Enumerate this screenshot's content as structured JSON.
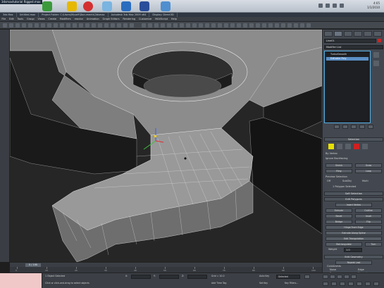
{
  "taskbar": {
    "title": "3dsmaxtutorial Rigged.max",
    "clock_time": "4:05",
    "clock_date": "1/1/2010",
    "icon_colors": [
      "#3a9a3a",
      "#e6b800",
      "#d43030",
      "#7ab4e0",
      "#2a6dbf",
      "#2b4e9a",
      "#4f8fcf"
    ]
  },
  "max_window": {
    "title_segments": [
      "3ds Max",
      "Untitled.max",
      "Project Folder: C:\\Users\\Myself\\Documents\\3dsmax",
      "Autodesk 3ds Max 2009 x64",
      "Display: Direct3D"
    ],
    "menu_items": [
      "File",
      "Edit",
      "Tools",
      "Group",
      "Views",
      "Create",
      "Modifiers",
      "reactor",
      "Animation",
      "Graph Editors",
      "Rendering",
      "Customize",
      "MAXScript",
      "Help"
    ]
  },
  "command_panel": {
    "object_name": "Line01",
    "modifier_list": "Modifier List",
    "stack_items": [
      {
        "label": "TurboSmooth",
        "selected": false
      },
      {
        "label": "Editable Poly",
        "selected": true
      }
    ],
    "rollout_selection": "Selection",
    "label_by_vertex": "By Vertex",
    "label_ignore_backfacing": "Ignore Backfacing",
    "btn_shrink": "Shrink",
    "btn_grow": "Grow",
    "btn_ring": "Ring",
    "btn_loop": "Loop",
    "rollout_preview": "Preview Selection",
    "preview_off": "Off",
    "preview_subobj": "SubObj",
    "preview_multi": "Multi",
    "label_selected": "1 Polygon Selected",
    "rollout_soft_selection": "Soft Selection",
    "rollout_edit_polygons": "Edit Polygons",
    "btn_insert_vertex": "Insert Vertex",
    "btn_extrude": "Extrude",
    "btn_outline": "Outline",
    "btn_bevel": "Bevel",
    "btn_inset": "Inset",
    "btn_bridge": "Bridge",
    "btn_flip": "Flip",
    "btn_hinge": "Hinge From Edge",
    "btn_extrude_spline": "Extrude Along Spline",
    "btn_edit_tri": "Edit Triangulation",
    "btn_retriangulate": "Retriangulate",
    "btn_turn": "Turn",
    "label_weight": "Weight",
    "weight_value": "1.0",
    "rollout_edit_geometry": "Edit Geometry",
    "btn_repeat_last": "Repeat Last",
    "label_constraints": "Constraints",
    "radio_none": "None",
    "radio_edge": "Edge",
    "radio_face": "Face",
    "radio_normal": "Normal",
    "label_preserve_uvs": "Preserve UVs",
    "swatch_colors": [
      "#e8e000",
      "#d02020"
    ]
  },
  "timeslider": {
    "label": "0 / 100",
    "ticks": [
      "0",
      "10",
      "20",
      "30",
      "40",
      "50",
      "60",
      "70",
      "80",
      "90",
      "100"
    ]
  },
  "statusbar": {
    "selected_text": "1 Object Selected",
    "prompt_text": "Click or click-and-drag to select objects",
    "x_label": "X:",
    "y_label": "Y:",
    "z_label": "Z:",
    "grid_text": "Grid = 10.0",
    "auto_key": "Auto Key",
    "set_key": "Set Key",
    "selected_dropdown": "Selected",
    "key_filters": "Key Filters...",
    "add_time_tag": "Add Time Tag"
  },
  "colors": {
    "viewport_bg": "#2a2a2a",
    "mesh_face": "#8a8a8a",
    "mesh_dark": "#1f1f1f",
    "selection_highlight": "#5b8fc6",
    "wire": "#e8e8e8"
  }
}
